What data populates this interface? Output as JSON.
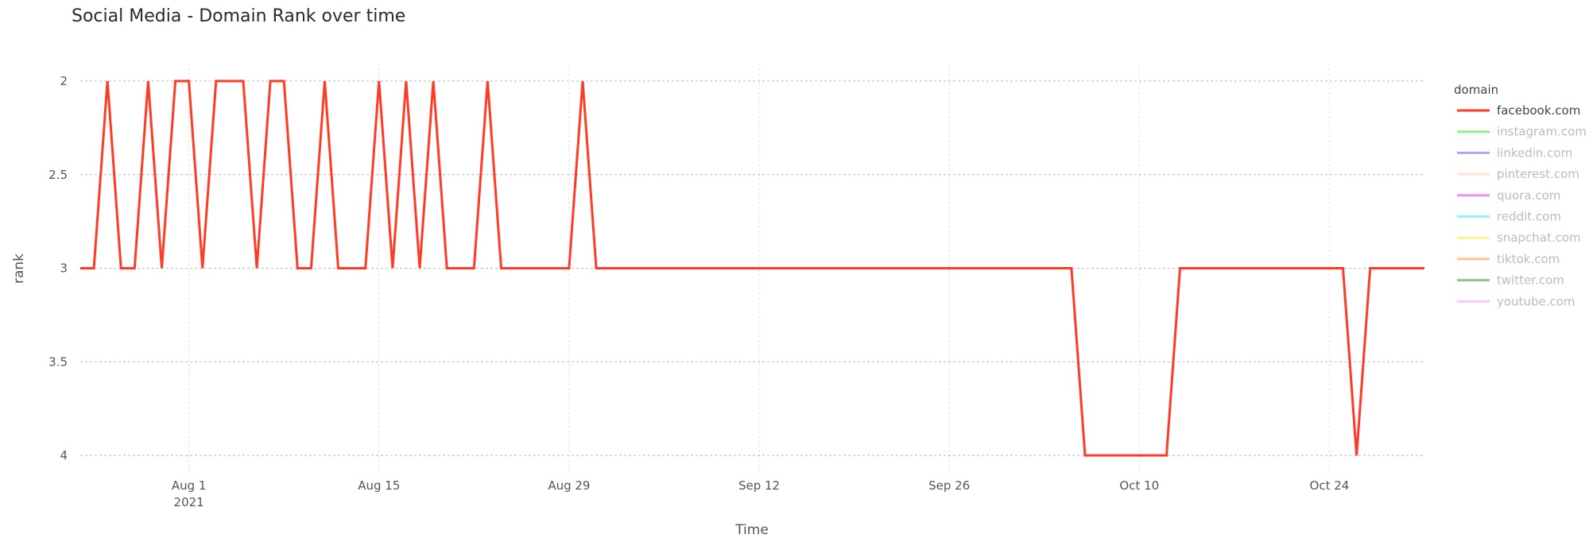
{
  "chart_data": {
    "type": "line",
    "title": "Social Media - Domain Rank over time",
    "xlabel": "Time",
    "ylabel": "rank",
    "y_reversed": true,
    "ylim": [
      2,
      4
    ],
    "yticks": [
      2,
      2.5,
      3,
      3.5,
      4
    ],
    "ytick_labels": [
      "2",
      "2.5",
      "3",
      "3.5",
      "4"
    ],
    "xlim": [
      "2021-07-24",
      "2021-10-31"
    ],
    "xticks": [
      "2021-08-01",
      "2021-08-15",
      "2021-08-29",
      "2021-09-12",
      "2021-09-26",
      "2021-10-10",
      "2021-10-24"
    ],
    "xtick_labels": [
      "Aug 1",
      "Aug 15",
      "Aug 29",
      "Sep 12",
      "Sep 26",
      "Oct 10",
      "Oct 24"
    ],
    "xtick_sublabel": "2021",
    "grid": true,
    "legend": {
      "title": "domain",
      "placement": "right",
      "entries": [
        {
          "name": "facebook.com",
          "color": "#ff3b26",
          "active": true
        },
        {
          "name": "instagram.com",
          "color": "#8ef08e",
          "active": false
        },
        {
          "name": "linkedin.com",
          "color": "#a8a8f8",
          "active": false
        },
        {
          "name": "pinterest.com",
          "color": "#fde0d6",
          "active": false
        },
        {
          "name": "quora.com",
          "color": "#f88af0",
          "active": false
        },
        {
          "name": "reddit.com",
          "color": "#8ef6f6",
          "active": false
        },
        {
          "name": "snapchat.com",
          "color": "#f8f68e",
          "active": false
        },
        {
          "name": "tiktok.com",
          "color": "#fcc48e",
          "active": false
        },
        {
          "name": "twitter.com",
          "color": "#8ec48e",
          "active": false
        },
        {
          "name": "youtube.com",
          "color": "#f8c8f8",
          "active": false
        }
      ]
    },
    "series": [
      {
        "name": "facebook.com",
        "color": "#ff3b26",
        "start_date": "2021-07-24",
        "interval_days": 1,
        "values": [
          3,
          3,
          2,
          3,
          3,
          2,
          3,
          2,
          2,
          3,
          2,
          2,
          2,
          3,
          2,
          2,
          3,
          3,
          2,
          3,
          3,
          3,
          2,
          3,
          2,
          3,
          2,
          3,
          3,
          3,
          2,
          3,
          3,
          3,
          3,
          3,
          3,
          2,
          3,
          3,
          3,
          3,
          3,
          3,
          3,
          3,
          3,
          3,
          3,
          3,
          3,
          3,
          3,
          3,
          3,
          3,
          3,
          3,
          3,
          3,
          3,
          3,
          3,
          3,
          3,
          3,
          3,
          3,
          3,
          3,
          3,
          3,
          3,
          3,
          4,
          4,
          4,
          4,
          4,
          4,
          4,
          3,
          3,
          3,
          3,
          3,
          3,
          3,
          3,
          3,
          3,
          3,
          3,
          3,
          4,
          3,
          3,
          3,
          3,
          3
        ]
      }
    ]
  }
}
